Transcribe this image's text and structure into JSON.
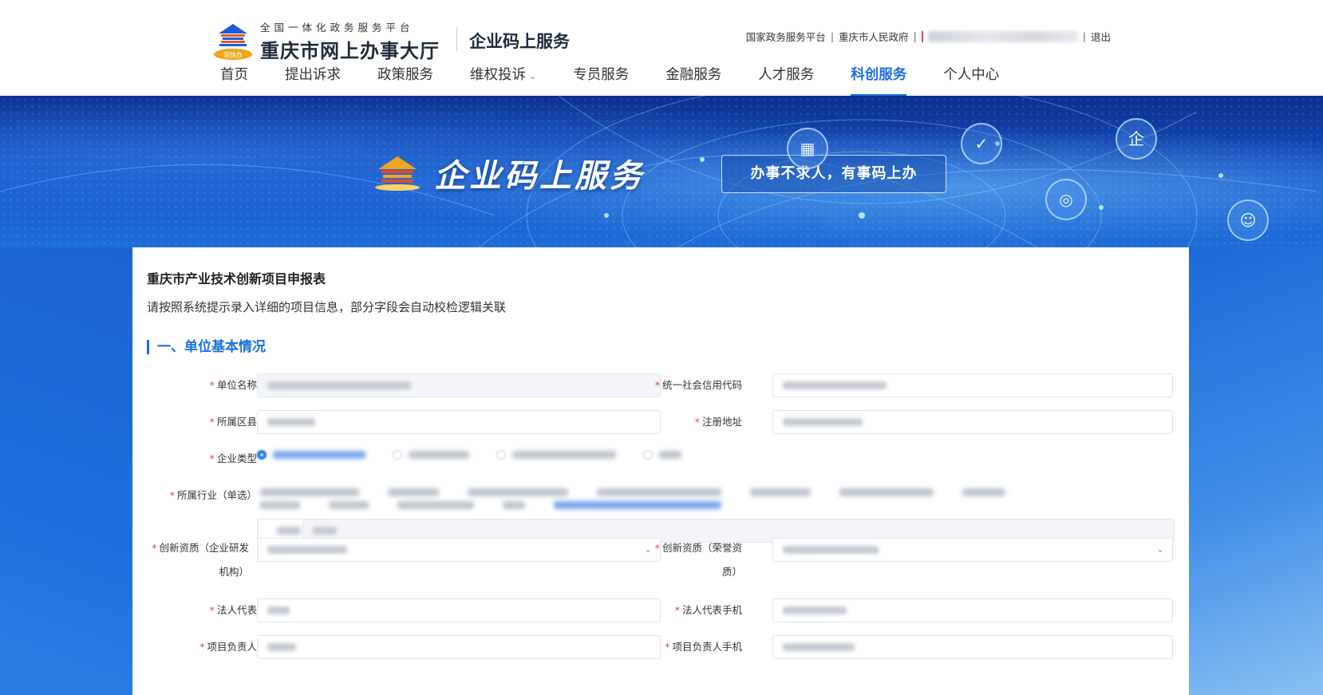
{
  "header": {
    "portal_tag": "全国一体化政务服务平台",
    "portal_name": "重庆市网上办事大厅",
    "emblem_badge": "渝快办",
    "site_name": "企业码上服务",
    "links": {
      "national": "国家政务服务平台",
      "city_gov": "重庆市人民政府",
      "logout": "退出"
    }
  },
  "nav": {
    "items": [
      {
        "label": "首页"
      },
      {
        "label": "提出诉求"
      },
      {
        "label": "政策服务"
      },
      {
        "label": "维权投诉",
        "has_dropdown": true
      },
      {
        "label": "专员服务"
      },
      {
        "label": "金融服务"
      },
      {
        "label": "人才服务"
      },
      {
        "label": "科创服务",
        "active": true
      },
      {
        "label": "个人中心"
      }
    ],
    "chevron": "⌄"
  },
  "banner": {
    "title": "企业码上服务",
    "slogan": "办事不求人，有事码上办",
    "icons": [
      "building-icon",
      "clipboard-check-icon",
      "enterprise-icon",
      "handshake-icon",
      "user-badge-icon"
    ]
  },
  "form": {
    "title": "重庆市产业技术创新项目申报表",
    "description": "请按照系统提示录入详细的项目信息，部分字段会自动校检逻辑关联",
    "section1_title": "一、单位基本情况",
    "labels": {
      "unit_name": "单位名称",
      "credit_code": "统一社会信用代码",
      "district": "所属区县",
      "reg_address": "注册地址",
      "enterprise_type": "企业类型",
      "industry": "所属行业（单选）",
      "innov_qual_rd_1": "创新资质（企业研发",
      "innov_qual_rd_2": "机构）",
      "innov_qual_honor_1": "创新资质（荣誉资",
      "innov_qual_honor_2": "质）",
      "legal_rep": "法人代表",
      "legal_rep_phone": "法人代表手机",
      "project_lead": "项目负责人",
      "project_lead_phone": "项目负责人手机"
    },
    "required_mark": "*",
    "select_arrow": "⌄"
  },
  "colors": {
    "accent": "#1a6fe0",
    "required": "#e14545",
    "banner_dark": "#0d2f8f"
  }
}
